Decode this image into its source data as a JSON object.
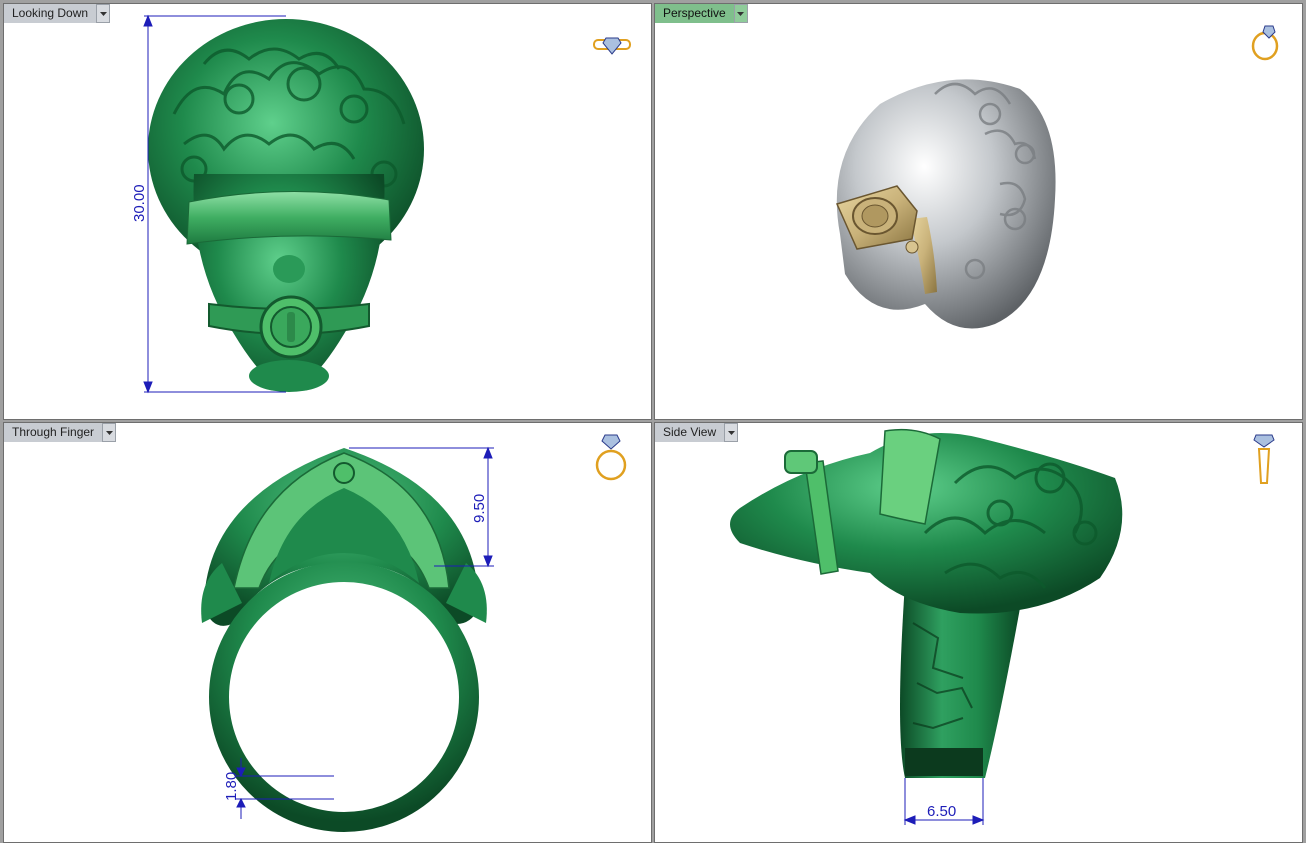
{
  "viewports": {
    "top_left": {
      "title": "Looking Down",
      "dimension": "30.00"
    },
    "top_right": {
      "title": "Perspective"
    },
    "bottom_left": {
      "title": "Through Finger",
      "dimension_height": "9.50",
      "dimension_thickness": "1.80"
    },
    "bottom_right": {
      "title": "Side View",
      "dimension_width": "6.50"
    }
  },
  "colors": {
    "model_green": "#1f8a4c",
    "model_green_dark": "#0c4a26",
    "model_green_light": "#5fd08c",
    "accent_green": "#4fbf6a",
    "silver": "#c4c8cc",
    "gold": "#c9b27a",
    "dimension_blue": "#1d1db8",
    "active_tab": "#7fbf8c"
  },
  "icons": {
    "top_left": "ring-top-view-icon",
    "top_right": "ring-perspective-icon",
    "bottom_left": "ring-front-view-icon",
    "bottom_right": "ring-side-view-icon"
  }
}
